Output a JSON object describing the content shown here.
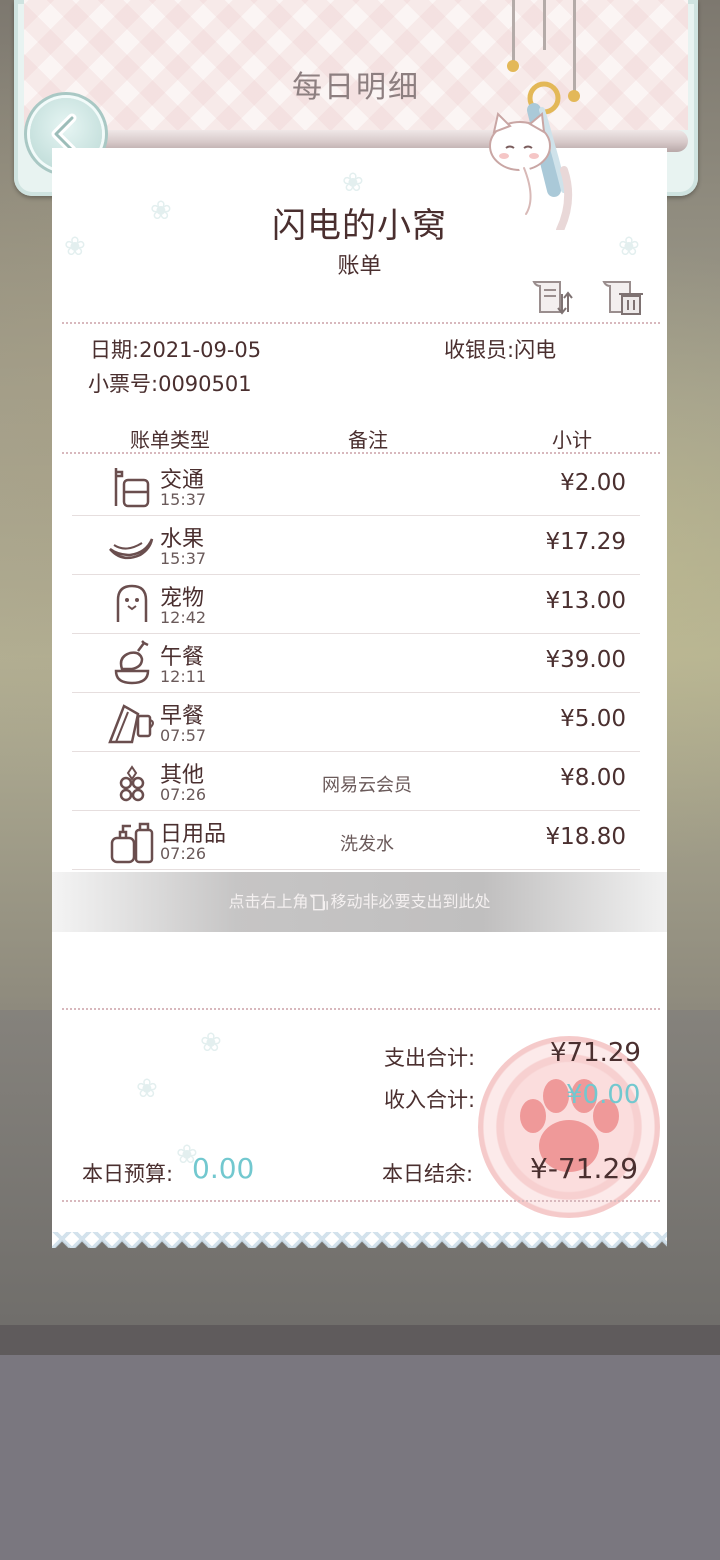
{
  "header": {
    "title": "每日明细",
    "back_label": "back"
  },
  "receipt": {
    "shop_name": "闪电的小窝",
    "bill_label": "账单",
    "date_label": "日期:",
    "date_value": "2021-09-05",
    "cashier_label": "收银员:",
    "cashier_value": "闪电",
    "ticket_label": "小票号:",
    "ticket_value": "0090501",
    "columns": [
      "账单类型",
      "备注",
      "小计"
    ],
    "items": [
      {
        "name": "交通",
        "time": "15:37",
        "note": "",
        "amount": "¥2.00",
        "icon": "bus-stop-icon"
      },
      {
        "name": "水果",
        "time": "15:37",
        "note": "",
        "amount": "¥17.29",
        "icon": "banana-icon"
      },
      {
        "name": "宠物",
        "time": "12:42",
        "note": "",
        "amount": "¥13.00",
        "icon": "pet-icon"
      },
      {
        "name": "午餐",
        "time": "12:11",
        "note": "",
        "amount": "¥39.00",
        "icon": "chicken-leg-icon"
      },
      {
        "name": "早餐",
        "time": "07:57",
        "note": "",
        "amount": "¥5.00",
        "icon": "sandwich-icon"
      },
      {
        "name": "其他",
        "time": "07:26",
        "note": "网易云会员",
        "amount": "¥8.00",
        "icon": "circles-icon"
      },
      {
        "name": "日用品",
        "time": "07:26",
        "note": "洗发水",
        "amount": "¥18.80",
        "icon": "bottles-icon"
      }
    ],
    "hint_before": "点击右上角",
    "hint_after": "移动非必要支出到此处",
    "expense_total_label": "支出合计:",
    "expense_total_value": "¥71.29",
    "income_total_label": "收入合计:",
    "income_total_value": "¥0.00",
    "budget_label": "本日预算:",
    "budget_value": "0.00",
    "balance_label": "本日结余:",
    "balance_value": "¥-71.29"
  },
  "colors": {
    "text_brown": "#4a2f2f",
    "accent_teal": "#72c8cf",
    "stamp_pink": "#eba0a0"
  }
}
